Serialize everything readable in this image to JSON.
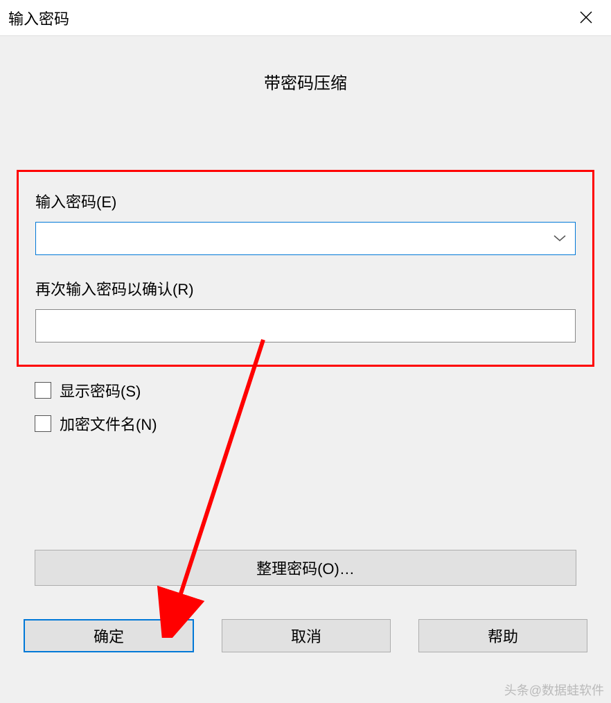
{
  "titlebar": {
    "title": "输入密码",
    "close_icon": "close"
  },
  "heading": "带密码压缩",
  "fields": {
    "password_label": "输入密码(E)",
    "password_value": "",
    "confirm_label": "再次输入密码以确认(R)",
    "confirm_value": ""
  },
  "checkboxes": {
    "show_password": {
      "label": "显示密码(S)",
      "checked": false
    },
    "encrypt_names": {
      "label": "加密文件名(N)",
      "checked": false
    }
  },
  "buttons": {
    "manage": "整理密码(O)…",
    "ok": "确定",
    "cancel": "取消",
    "help": "帮助"
  },
  "watermark": "头条@数据蛙软件"
}
